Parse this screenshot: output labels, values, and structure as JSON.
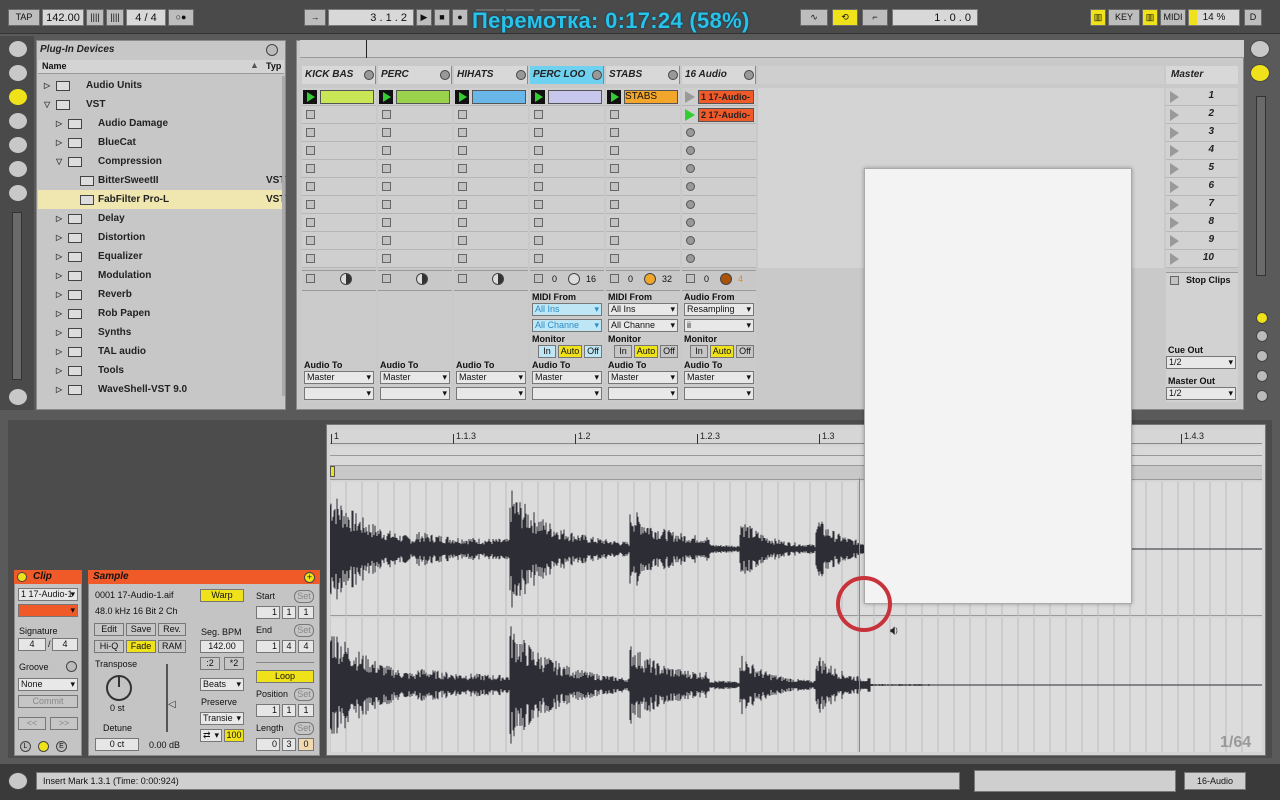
{
  "transport": {
    "tap_label": "TAP",
    "tempo": "142.00",
    "signature": "4 / 4",
    "position": "3 .  1 .  2",
    "loop_length": "1 .  0 .  0",
    "key_label": "KEY",
    "midi_label": "MIDI",
    "cpu": "14 %",
    "d_label": "D"
  },
  "overlay": {
    "rewind_text": "Перемотка: 0:17:24 (58%)"
  },
  "browser": {
    "title": "Plug-In Devices",
    "col_name": "Name",
    "col_type": "Typ",
    "items": [
      {
        "label": "Audio Units",
        "type": ""
      },
      {
        "label": "VST",
        "type": ""
      },
      {
        "label": "Audio Damage",
        "type": ""
      },
      {
        "label": "BlueCat",
        "type": ""
      },
      {
        "label": "Compression",
        "type": ""
      },
      {
        "label": "BitterSweetII",
        "type": "VST"
      },
      {
        "label": "FabFilter Pro-L",
        "type": "VST"
      },
      {
        "label": "Delay",
        "type": ""
      },
      {
        "label": "Distortion",
        "type": ""
      },
      {
        "label": "Equalizer",
        "type": ""
      },
      {
        "label": "Modulation",
        "type": ""
      },
      {
        "label": "Reverb",
        "type": ""
      },
      {
        "label": "Rob Papen",
        "type": ""
      },
      {
        "label": "Synths",
        "type": ""
      },
      {
        "label": "TAL audio",
        "type": ""
      },
      {
        "label": "Tools",
        "type": ""
      },
      {
        "label": "WaveShell-VST 9.0",
        "type": ""
      }
    ]
  },
  "tracks": [
    {
      "name": "KICK BAS",
      "clip": "",
      "clip_color": "#c8e655"
    },
    {
      "name": "PERC",
      "clip": "",
      "clip_color": "#9bd24c"
    },
    {
      "name": "HIHATS",
      "clip": "",
      "clip_color": "#69b6e8"
    },
    {
      "name": "PERC LOO",
      "clip": "",
      "clip_color": "#c7c7ee"
    },
    {
      "name": "STABS",
      "clip": "STABS",
      "clip_color": "#f2a72c"
    },
    {
      "name": "16 Audio",
      "clip": "1 17-Audio-",
      "clip2": "2 17-Audio-",
      "clip_color": "#f05a28"
    }
  ],
  "track_io": {
    "audio_to": "Audio To",
    "master": "Master",
    "midi_from": "MIDI From",
    "audio_from": "Audio From",
    "all_ins": "All Ins",
    "all_channels": "All Channe",
    "resampling": "Resampling",
    "monitor": "Monitor",
    "in": "In",
    "auto": "Auto",
    "off": "Off",
    "zero": "0",
    "sixteen": "16",
    "thirtytwo": "32",
    "four": "4"
  },
  "master": {
    "title": "Master",
    "scenes": [
      "1",
      "2",
      "3",
      "4",
      "5",
      "6",
      "7",
      "8",
      "9",
      "10"
    ],
    "stop_clips": "Stop Clips",
    "cue_out": "Cue Out",
    "cue_value": "1/2",
    "master_out": "Master Out",
    "master_value": "1/2"
  },
  "clip_view": {
    "clip_title": "Clip",
    "clip_name": "1 17-Audio-1",
    "signature_label": "Signature",
    "sig_num": "4",
    "sig_den": "4",
    "groove_label": "Groove",
    "groove_value": "None",
    "commit": "Commit",
    "sample_title": "Sample",
    "file_name": "0001 17-Audio-1.aif",
    "file_info": "48.0 kHz 16 Bit 2 Ch",
    "edit": "Edit",
    "save": "Save",
    "rev": "Rev.",
    "hiq": "Hi-Q",
    "fade": "Fade",
    "ram": "RAM",
    "transpose_label": "Transpose",
    "transpose_value": "0 st",
    "detune_label": "Detune",
    "detune_value": "0 ct",
    "gain_value": "0.00 dB",
    "warp": "Warp",
    "seg_bpm_label": "Seg. BPM",
    "seg_bpm": "142.00",
    "half": ":2",
    "double": "*2",
    "beats": "Beats",
    "preserve_label": "Preserve",
    "transient": "Transie",
    "grain": "100",
    "start_label": "Start",
    "end_label": "End",
    "set": "Set",
    "start_vals": [
      "1",
      "1",
      "1"
    ],
    "end_vals": [
      "1",
      "4",
      "4"
    ],
    "loop": "Loop",
    "position_label": "Position",
    "position_vals": [
      "1",
      "1",
      "1"
    ],
    "length_label": "Length",
    "length_vals": [
      "0",
      "3",
      "0"
    ],
    "prev": "<<",
    "next": ">>"
  },
  "ruler": {
    "ticks": [
      "1",
      "1.1.3",
      "1.2",
      "1.2.3",
      "1.3",
      "1.4.3"
    ],
    "zoom": "1/64"
  },
  "status": {
    "message": "Insert Mark 1.3.1 (Time: 0:00:924)",
    "track": "16-Audio"
  }
}
